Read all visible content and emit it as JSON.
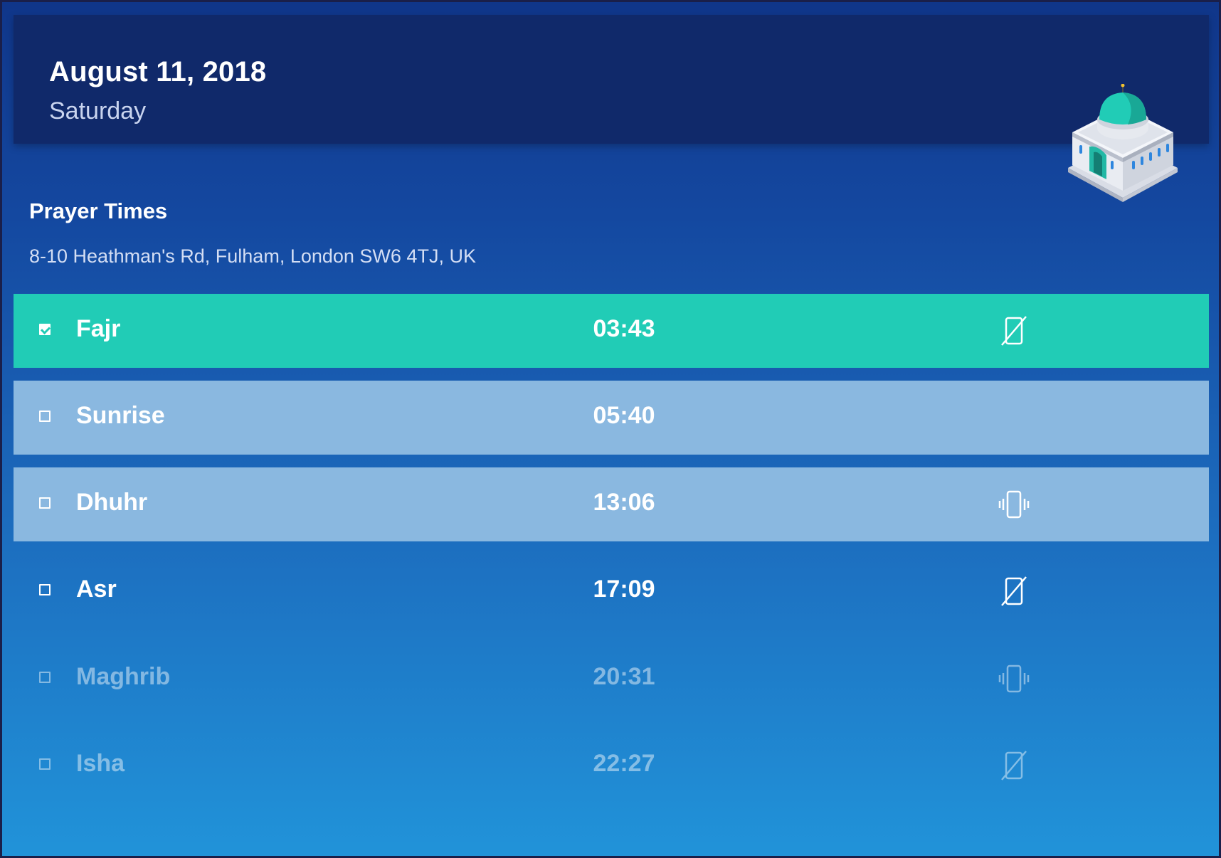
{
  "header": {
    "date": "August 11, 2018",
    "weekday": "Saturday"
  },
  "section": {
    "title": "Prayer Times",
    "address": "8-10 Heathman's Rd, Fulham, London SW6 4TJ, UK"
  },
  "colors": {
    "active_row": "#21ccb6",
    "highlight_row": "#8ab8e0",
    "header_bg": "#10296a"
  },
  "prayers": [
    {
      "name": "Fajr",
      "time": "03:43",
      "checked": true,
      "alert_icon": "phone-silent-icon",
      "state": "active"
    },
    {
      "name": "Sunrise",
      "time": "05:40",
      "checked": false,
      "alert_icon": "",
      "state": "highlight"
    },
    {
      "name": "Dhuhr",
      "time": "13:06",
      "checked": false,
      "alert_icon": "phone-vibrate-icon",
      "state": "highlight"
    },
    {
      "name": "Asr",
      "time": "17:09",
      "checked": false,
      "alert_icon": "phone-silent-icon",
      "state": "normal"
    },
    {
      "name": "Maghrib",
      "time": "20:31",
      "checked": false,
      "alert_icon": "phone-vibrate-icon",
      "state": "dim"
    },
    {
      "name": "Isha",
      "time": "22:27",
      "checked": false,
      "alert_icon": "phone-silent-icon",
      "state": "dim"
    }
  ]
}
